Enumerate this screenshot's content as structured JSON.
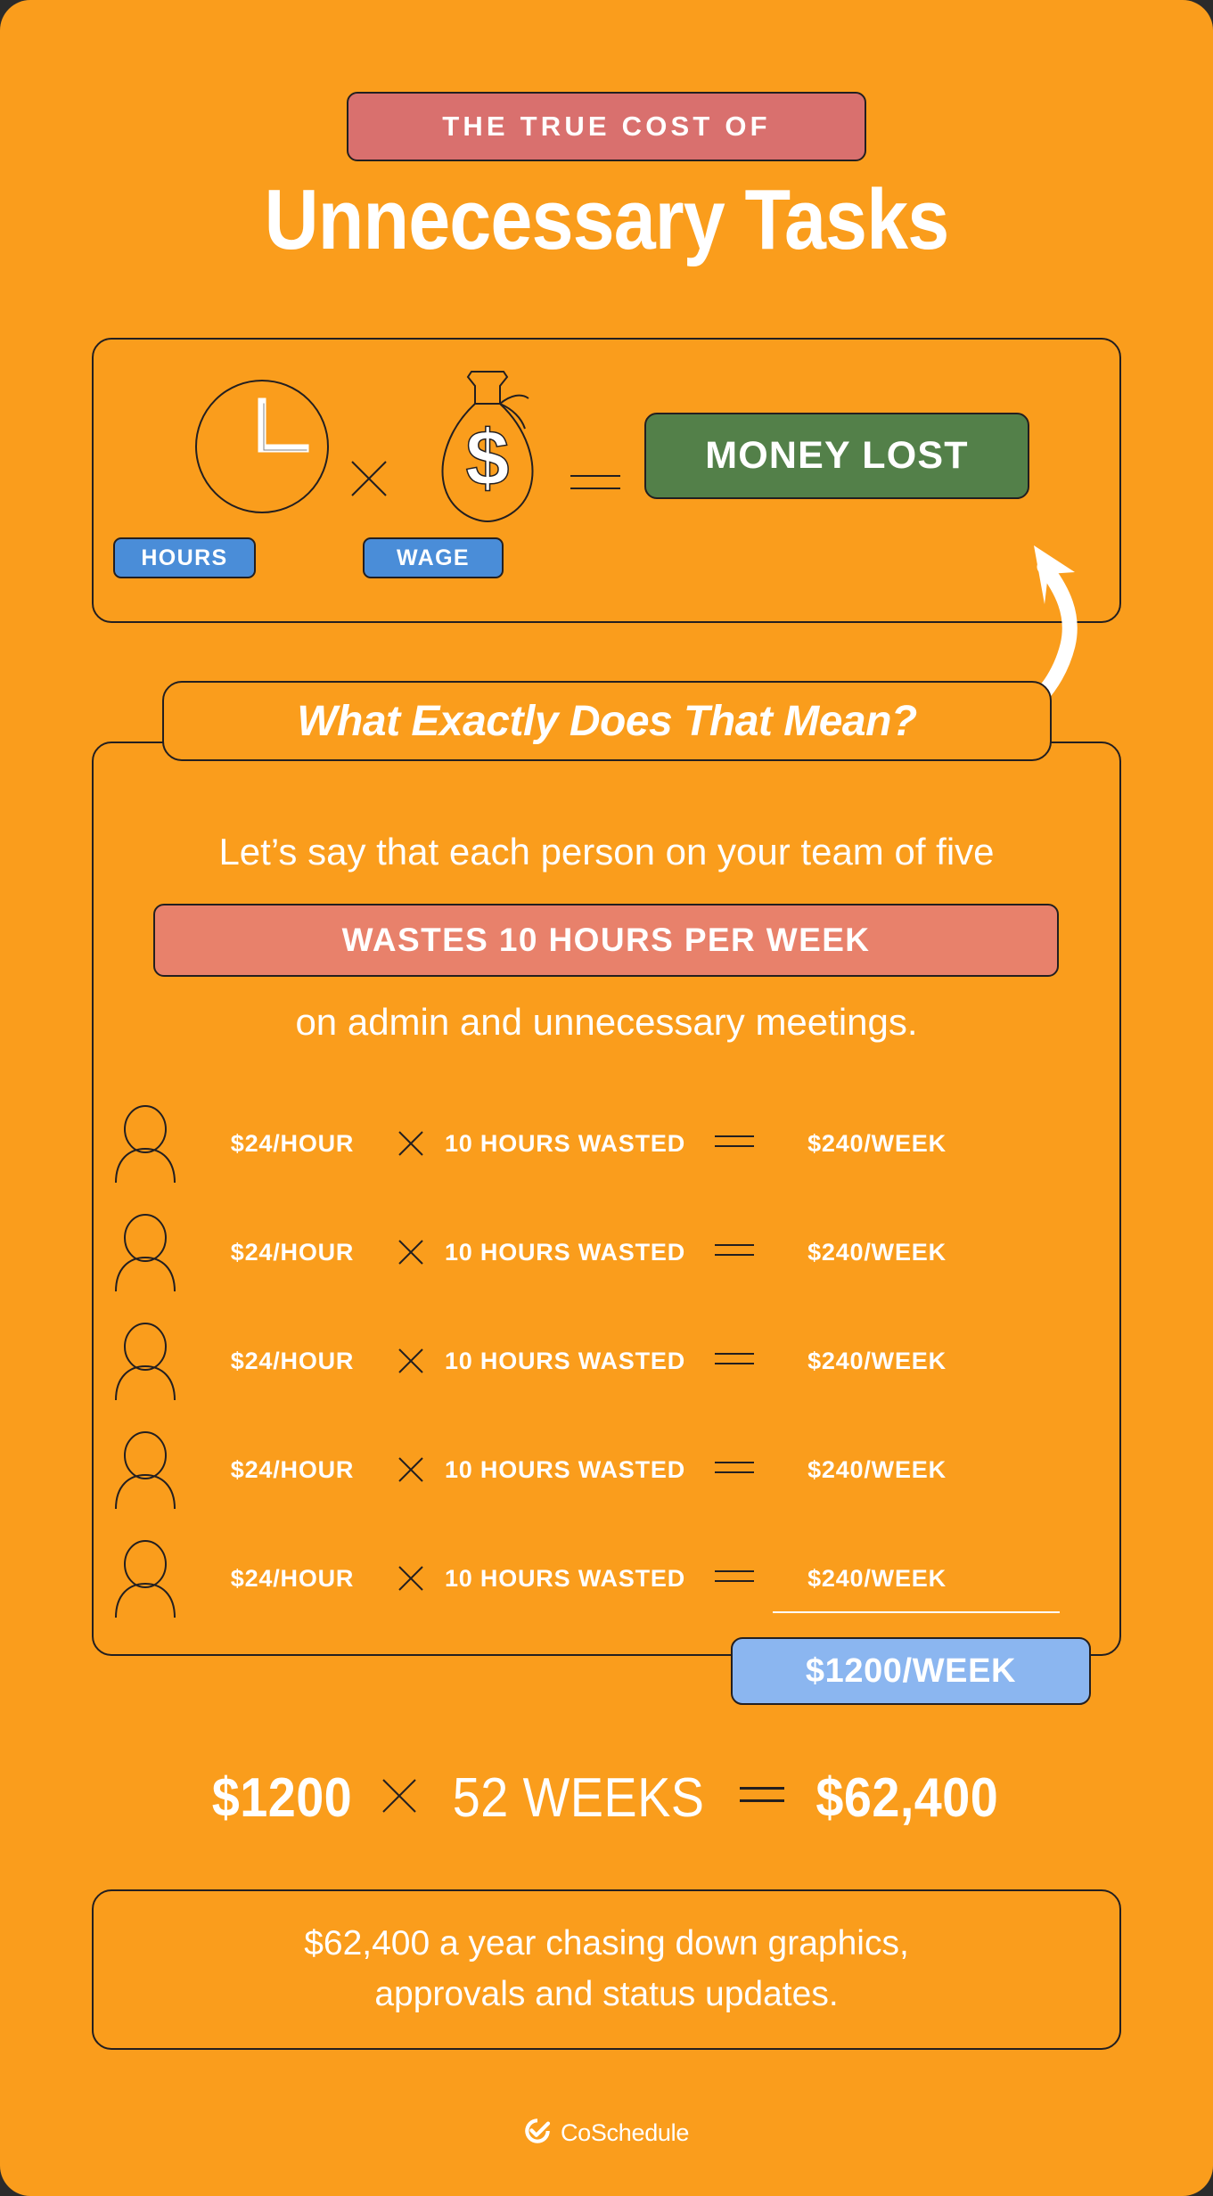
{
  "theme": {
    "background": "#FA9D1C",
    "stroke": "#231f20",
    "white": "#FFFFFF",
    "badge_rose": "#D9706E",
    "money_green": "#538049",
    "tag_blue": "#4A8DD8",
    "salmon": "#E8816B",
    "total_blue": "#8BB6F0"
  },
  "header": {
    "eyebrow": "THE TRUE COST OF",
    "title": "Unnecessary Tasks"
  },
  "formula": {
    "clock_icon": "clock-icon",
    "times_symbol": "times-icon",
    "bag_icon": "money-bag-icon",
    "equals_symbol": "equals-icon",
    "result_label": "MONEY LOST",
    "hours_tag": "HOURS",
    "wage_tag": "WAGE",
    "arrow_icon": "curved-arrow-icon"
  },
  "breakdown": {
    "question": "What Exactly Does That Mean?",
    "lede_top": "Let’s say that each person on your team of five",
    "highlight": "WASTES 10 HOURS PER WEEK",
    "lede_bottom": "on admin and unnecessary meetings.",
    "rows": [
      {
        "rate": "$24/HOUR",
        "times": "×",
        "hours": "10 HOURS WASTED",
        "equals": "=",
        "result": "$240/WEEK"
      },
      {
        "rate": "$24/HOUR",
        "times": "×",
        "hours": "10 HOURS WASTED",
        "equals": "=",
        "result": "$240/WEEK"
      },
      {
        "rate": "$24/HOUR",
        "times": "×",
        "hours": "10 HOURS WASTED",
        "equals": "=",
        "result": "$240/WEEK"
      },
      {
        "rate": "$24/HOUR",
        "times": "×",
        "hours": "10 HOURS WASTED",
        "equals": "=",
        "result": "$240/WEEK"
      },
      {
        "rate": "$24/HOUR",
        "times": "×",
        "hours": "10 HOURS WASTED",
        "equals": "=",
        "result": "$240/WEEK"
      }
    ],
    "total": "$1200/WEEK"
  },
  "year_equation": {
    "weekly": "$1200",
    "times": "×",
    "weeks": "52 WEEKS",
    "equals": "=",
    "annual": "$62,400"
  },
  "footer": {
    "line1": "$62,400 a year chasing down graphics,",
    "line2": "approvals and status updates."
  },
  "logo": {
    "mark": "coschedule-check-icon",
    "text": "CoSchedule"
  },
  "chart_data": {
    "type": "table",
    "title": "The True Cost of Unnecessary Tasks",
    "columns": [
      "Person",
      "Hourly rate ($/hour)",
      "Hours wasted per week",
      "Weekly cost ($)"
    ],
    "rows": [
      [
        "Person 1",
        24,
        10,
        240
      ],
      [
        "Person 2",
        24,
        10,
        240
      ],
      [
        "Person 3",
        24,
        10,
        240
      ],
      [
        "Person 4",
        24,
        10,
        240
      ],
      [
        "Person 5",
        24,
        10,
        240
      ]
    ],
    "totals": {
      "team_size": 5,
      "weekly_total": 1200,
      "weeks_per_year": 52,
      "annual_total": 62400
    },
    "annotations": [
      "HOURS × WAGE = MONEY LOST",
      "WASTES 10 HOURS PER WEEK",
      "$1200 × 52 WEEKS = $62,400"
    ]
  }
}
